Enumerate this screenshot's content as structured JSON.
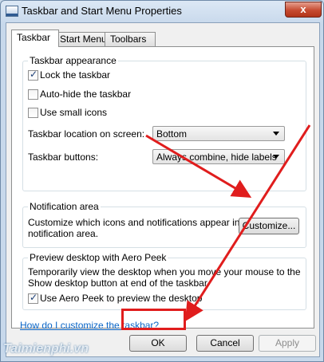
{
  "window": {
    "title": "Taskbar and Start Menu Properties",
    "close_glyph": "x"
  },
  "tabs": [
    {
      "label": "Taskbar"
    },
    {
      "label": "Start Menu"
    },
    {
      "label": "Toolbars"
    }
  ],
  "taskbar_appearance": {
    "title": "Taskbar appearance",
    "lock_taskbar": {
      "label": "Lock the taskbar",
      "checked": true
    },
    "auto_hide": {
      "label": "Auto-hide the taskbar",
      "checked": false
    },
    "small_icons": {
      "label": "Use small icons",
      "checked": false
    },
    "location_label": "Taskbar location on screen:",
    "location_value": "Bottom",
    "buttons_label": "Taskbar buttons:",
    "buttons_value": "Always combine, hide labels"
  },
  "notification_area": {
    "title": "Notification area",
    "description_line1": "Customize which icons and notifications appear in the",
    "description_line2": "notification area.",
    "customize_label": "Customize..."
  },
  "aero_peek": {
    "title": "Preview desktop with Aero Peek",
    "description_line1": "Temporarily view the desktop when you move your mouse to the",
    "description_line2": "Show desktop button at end of the taskbar.",
    "use_aero_peek": {
      "label": "Use Aero Peek to preview the desktop",
      "checked": true
    }
  },
  "help_link": "How do I customize the taskbar?",
  "footer": {
    "ok_label": "OK",
    "cancel_label": "Cancel",
    "apply_label": "Apply"
  },
  "watermark": "Taimienphi.vn",
  "colors": {
    "annotation": "#e01d1d",
    "link": "#0b66c7"
  }
}
